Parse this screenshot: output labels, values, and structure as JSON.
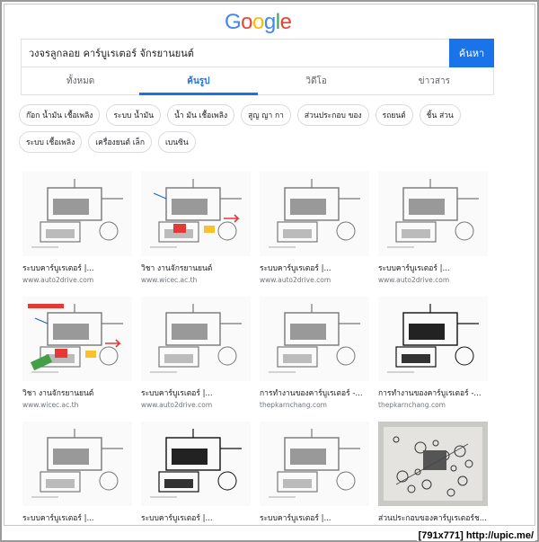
{
  "search": {
    "query": "วงจรลูกลอย คาร์บูเรเตอร์ จักรยานยนต์",
    "button_label": "ค้นหา"
  },
  "logo": {
    "letters": [
      "G",
      "o",
      "o",
      "g",
      "l",
      "e"
    ],
    "colors": [
      "#4285f4",
      "#ea4335",
      "#fbbc05",
      "#4285f4",
      "#34a853",
      "#ea4335"
    ]
  },
  "tabs": [
    {
      "label": "ทั้งหมด",
      "active": false
    },
    {
      "label": "ค้นรูป",
      "active": true
    },
    {
      "label": "วิดีโอ",
      "active": false
    },
    {
      "label": "ข่าวสาร",
      "active": false
    }
  ],
  "chips": [
    "ก๊อก น้ำมัน เชื้อเพลิง",
    "ระบบ น้ำมัน",
    "น้ำ มัน เชื้อเพลิง",
    "สูญ ญา กา",
    "ส่วนประกอบ ของ",
    "รถยนต์",
    "ชิ้น ส่วน",
    "ระบบ เชื้อเพลิง",
    "เครื่องยนต์ เล็ก",
    "เบนซิน"
  ],
  "results": [
    {
      "title": "ระบบคาร์บูเรเตอร์ |...",
      "source": "www.auto2drive.com",
      "kind": "gray"
    },
    {
      "title": "วิชา งานจักรยานยนต์",
      "source": "www.wicec.ac.th",
      "kind": "color"
    },
    {
      "title": "ระบบคาร์บูเรเตอร์ |...",
      "source": "www.auto2drive.com",
      "kind": "gray"
    },
    {
      "title": "ระบบคาร์บูเรเตอร์ |...",
      "source": "www.auto2drive.com",
      "kind": "gray"
    },
    {
      "title": "วิชา งานจักรยานยนต์",
      "source": "www.wicec.ac.th",
      "kind": "colorbig"
    },
    {
      "title": "ระบบคาร์บูเรเตอร์ |...",
      "source": "www.auto2drive.com",
      "kind": "gray"
    },
    {
      "title": "การทำงานของคาร์บูเรเตอร์ -...",
      "source": "thepkarnchang.com",
      "kind": "gray"
    },
    {
      "title": "การทำงานของคาร์บูเรเตอร์ -...",
      "source": "thepkarnchang.com",
      "kind": "dark"
    },
    {
      "title": "ระบบคาร์บูเรเตอร์ |...",
      "source": "",
      "kind": "gray"
    },
    {
      "title": "ระบบคาร์บูเรเตอร์ |...",
      "source": "",
      "kind": "dark"
    },
    {
      "title": "ระบบคาร์บูเรเตอร์ |...",
      "source": "",
      "kind": "gray"
    },
    {
      "title": "ส่วนประกอบของคาร์บูเรเตอร์ช...",
      "source": "",
      "kind": "photo"
    }
  ],
  "watermark": "[791x771] http://upic.me/"
}
